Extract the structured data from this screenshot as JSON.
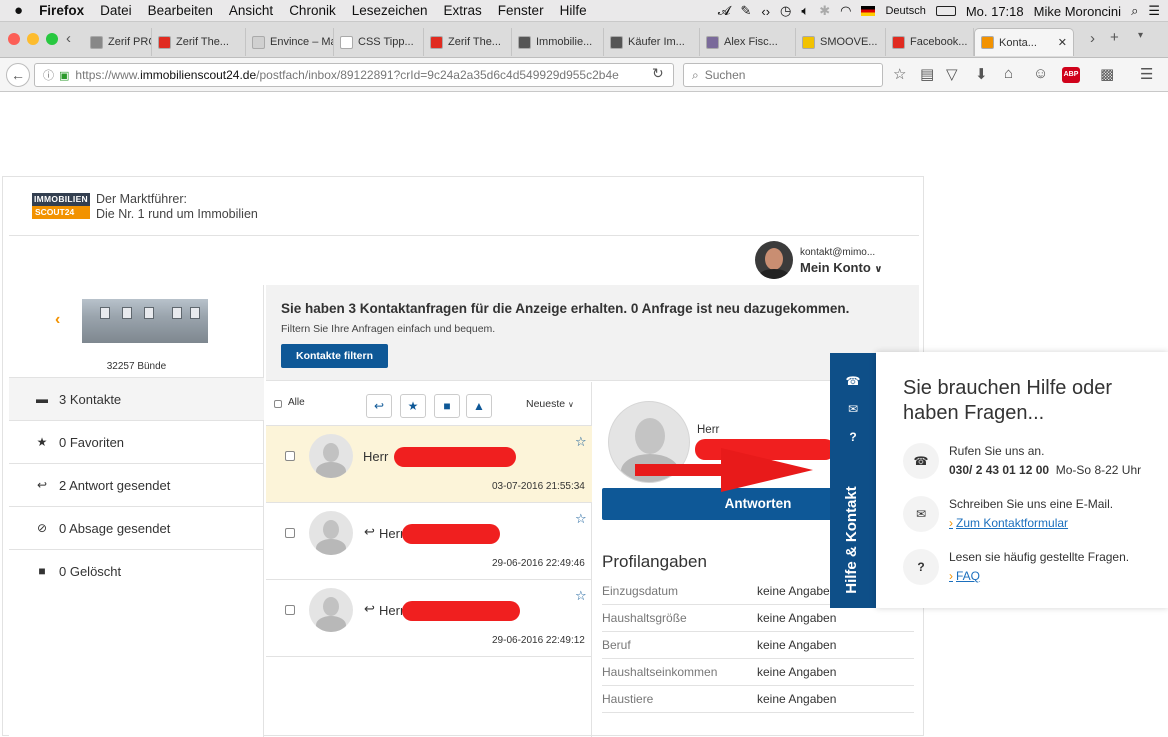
{
  "menubar": {
    "apple": "",
    "app": "Firefox",
    "items": [
      "Datei",
      "Bearbeiten",
      "Ansicht",
      "Chronik",
      "Lesezeichen",
      "Extras",
      "Fenster",
      "Hilfe"
    ],
    "language": "Deutsch",
    "clock": "Mo. 17:18",
    "user": "Mike Moroncini"
  },
  "tabs": [
    {
      "label": "Zerif PRO...",
      "color": "#888888"
    },
    {
      "label": "Zerif The...",
      "color": "#e02b20"
    },
    {
      "label": "Envince – Ma...",
      "color": "#d0d0d0"
    },
    {
      "label": "CSS Tipp...",
      "color": "#ffffff"
    },
    {
      "label": "Zerif The...",
      "color": "#e02b20"
    },
    {
      "label": "Immobilie...",
      "color": "#555555"
    },
    {
      "label": "Käufer Im...",
      "color": "#555555"
    },
    {
      "label": "Alex Fisc...",
      "color": "#7a6a9a"
    },
    {
      "label": "SMOOVE...",
      "color": "#f2c200"
    },
    {
      "label": "Facebook...",
      "color": "#e02b20"
    },
    {
      "label": "Konta...",
      "color": "#f29200"
    }
  ],
  "navbar": {
    "url_prefix": "https://www.",
    "url_domain": "immobilienscout24.de",
    "url_path": "/postfach/inbox/89122891?crId=9c24a2a35d6c4d549929d955c2b4e",
    "search_placeholder": "Suchen",
    "adblock_badge": "ABP"
  },
  "header": {
    "logo_top": "IMMOBILIEN",
    "logo_bottom": "SCOUT24",
    "tagline_1": "Der Marktführer:",
    "tagline_2": "Die Nr. 1 rund um Immobilien",
    "account_email": "kontakt@mimo...",
    "account_label": "Mein Konto"
  },
  "listing": {
    "location": "32257 Bünde"
  },
  "sidebar": {
    "items": [
      {
        "label": "3 Kontakte",
        "icon": "inbox-icon"
      },
      {
        "label": "0 Favoriten",
        "icon": "star-icon"
      },
      {
        "label": "2 Antwort gesendet",
        "icon": "reply-icon"
      },
      {
        "label": "0 Absage gesendet",
        "icon": "ban-icon"
      },
      {
        "label": "0 Gelöscht",
        "icon": "trash-icon"
      }
    ]
  },
  "banner": {
    "title": "Sie haben 3 Kontaktanfragen für die Anzeige erhalten. 0 Anfrage ist neu dazugekommen.",
    "subtitle": "Filtern Sie Ihre Anfragen einfach und bequem.",
    "filter_button": "Kontakte filtern"
  },
  "list": {
    "select_all": "Alle",
    "sort": "Neueste",
    "messages": [
      {
        "salutation": "Herr",
        "date": "03-07-2016 21:55:34",
        "replied": false,
        "active": true
      },
      {
        "salutation": "Herr",
        "date": "29-06-2016 22:49:46",
        "replied": true,
        "active": false
      },
      {
        "salutation": "Herr",
        "date": "29-06-2016 22:49:12",
        "replied": true,
        "active": false
      }
    ]
  },
  "detail": {
    "salutation": "Herr",
    "reply_button": "Antworten",
    "profile_title": "Profilangaben",
    "profile_rows": [
      {
        "key": "Einzugsdatum",
        "value": "keine Angaben"
      },
      {
        "key": "Haushaltsgröße",
        "value": "keine Angaben"
      },
      {
        "key": "Beruf",
        "value": "keine Angaben"
      },
      {
        "key": "Haushaltseinkommen",
        "value": "keine Angaben"
      },
      {
        "key": "Haustiere",
        "value": "keine Angaben"
      }
    ]
  },
  "help": {
    "tab_label": "Hilfe & Kontakt",
    "title": "Sie brauchen Hilfe oder haben Fragen...",
    "call_text": "Rufen Sie uns an.",
    "phone": "030/ 2 43 01 12 00",
    "hours": "Mo-So 8-22 Uhr",
    "email_text": "Schreiben Sie uns eine E-Mail.",
    "contact_link": "Zum Kontaktformular",
    "faq_text": "Lesen sie häufig gestellte Fragen.",
    "faq_link": "FAQ"
  },
  "colors": {
    "brand_blue": "#0e5897",
    "brand_orange": "#f29200",
    "redaction": "#f01f1f"
  }
}
